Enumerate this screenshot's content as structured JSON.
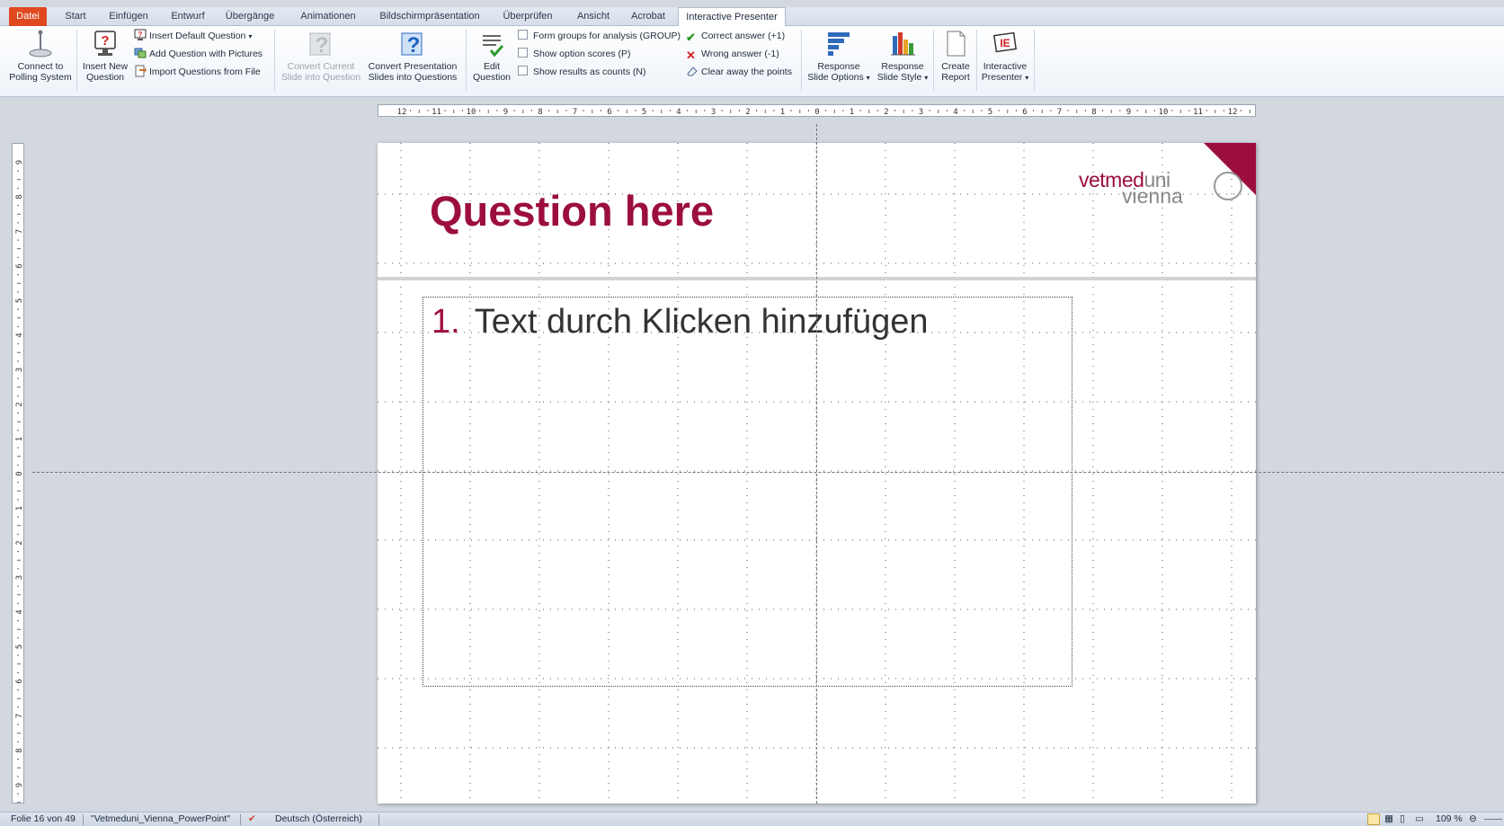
{
  "tabs": {
    "file": "Datei",
    "items": [
      "Start",
      "Einfügen",
      "Entwurf",
      "Übergänge",
      "Animationen",
      "Bildschirmpräsentation",
      "Überprüfen",
      "Ansicht",
      "Acrobat",
      "Interactive Presenter"
    ],
    "active": "Interactive Presenter"
  },
  "ribbon": {
    "connect": [
      "Connect to",
      "Polling System"
    ],
    "insert_new": [
      "Insert New",
      "Question"
    ],
    "insert_default": "Insert Default Question",
    "add_pictures": "Add Question with Pictures",
    "import_file": "Import Questions from File",
    "convert_current": [
      "Convert Current",
      "Slide into Question"
    ],
    "convert_presentation": [
      "Convert Presentation",
      "Slides into Questions"
    ],
    "edit_question": [
      "Edit",
      "Question"
    ],
    "form_groups": "Form groups for analysis (GROUP)",
    "show_scores": "Show option scores (P)",
    "show_counts": "Show results as counts (N)",
    "correct_answer": "Correct answer (+1)",
    "wrong_answer": "Wrong answer (-1)",
    "clear_points": "Clear away the points",
    "response_options": [
      "Response",
      "Slide Options"
    ],
    "response_style": [
      "Response",
      "Slide Style"
    ],
    "create_report": [
      "Create",
      "Report"
    ],
    "interactive_presenter": [
      "Interactive",
      "Presenter"
    ]
  },
  "slide": {
    "title": "Question here",
    "bullet_number": "1.",
    "bullet_text": "Text durch Klicken hinzufügen",
    "logo_line1": "vetmed",
    "logo_line1_b": "uni",
    "logo_line2": "vienna"
  },
  "status": {
    "slide": "Folie 16 von 49",
    "theme": "\"Vetmeduni_Vienna_PowerPoint\"",
    "language": "Deutsch (Österreich)",
    "zoom": "109 %"
  },
  "colors": {
    "accent": "#9c0e3f",
    "file_tab": "#e0481f"
  }
}
